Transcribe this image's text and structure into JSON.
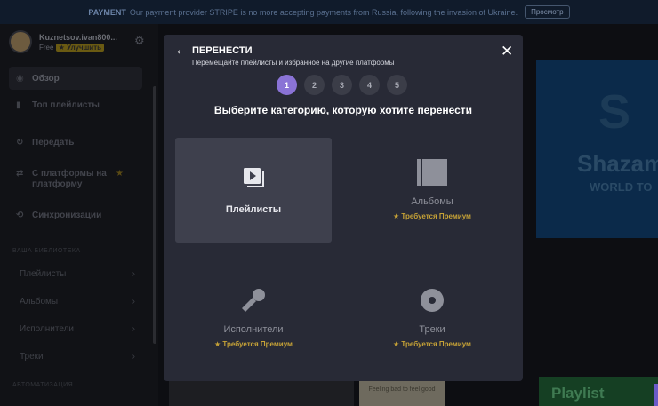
{
  "banner": {
    "prefix": "PAYMENT",
    "message": "Our payment provider STRIPE is no more accepting payments from Russia, following the invasion of Ukraine.",
    "button": "Просмотр"
  },
  "sidebar": {
    "user_name": "Kuznetsov.ivan800...",
    "plan": "Free",
    "upgrade_label": "Улучшить",
    "nav": [
      {
        "label": "Обзор",
        "icon": "compass-icon"
      },
      {
        "label": "Топ плейлисты",
        "icon": "chart-icon"
      },
      {
        "label": "Передать",
        "icon": "transfer-icon"
      },
      {
        "label": "С платформы на платформу",
        "icon": "platform-icon"
      },
      {
        "label": "Синхронизации",
        "icon": "sync-icon"
      }
    ],
    "library_label": "ВАША БИБЛИОТЕКА",
    "library": [
      {
        "label": "Плейлисты"
      },
      {
        "label": "Альбомы"
      },
      {
        "label": "Исполнители"
      },
      {
        "label": "Треки"
      }
    ],
    "automation_label": "АВТОМАТИЗАЦИЯ"
  },
  "background": {
    "shazam_title": "Shazam",
    "shazam_sub": "WORLD TO",
    "feeling_text": "Feeling bad to feel good",
    "playlist_label": "Playlist"
  },
  "modal": {
    "title": "ПЕРЕНЕСТИ",
    "subtitle": "Перемещайте плейлисты и избранное на другие платформы",
    "steps": [
      "1",
      "2",
      "3",
      "4",
      "5"
    ],
    "active_step": 1,
    "heading": "Выберите категорию, которую хотите перенести",
    "categories": [
      {
        "label": "Плейлисты",
        "premium": "",
        "icon": "playlist-icon"
      },
      {
        "label": "Альбомы",
        "premium": "Требуется Премиум",
        "icon": "album-icon"
      },
      {
        "label": "Исполнители",
        "premium": "Требуется Премиум",
        "icon": "microphone-icon"
      },
      {
        "label": "Треки",
        "premium": "Требуется Премиум",
        "icon": "disc-icon"
      }
    ]
  },
  "colors": {
    "accent": "#8a73d6",
    "premium": "#c6a237",
    "modal_bg": "#282a36",
    "selected_card": "#3e404d"
  }
}
